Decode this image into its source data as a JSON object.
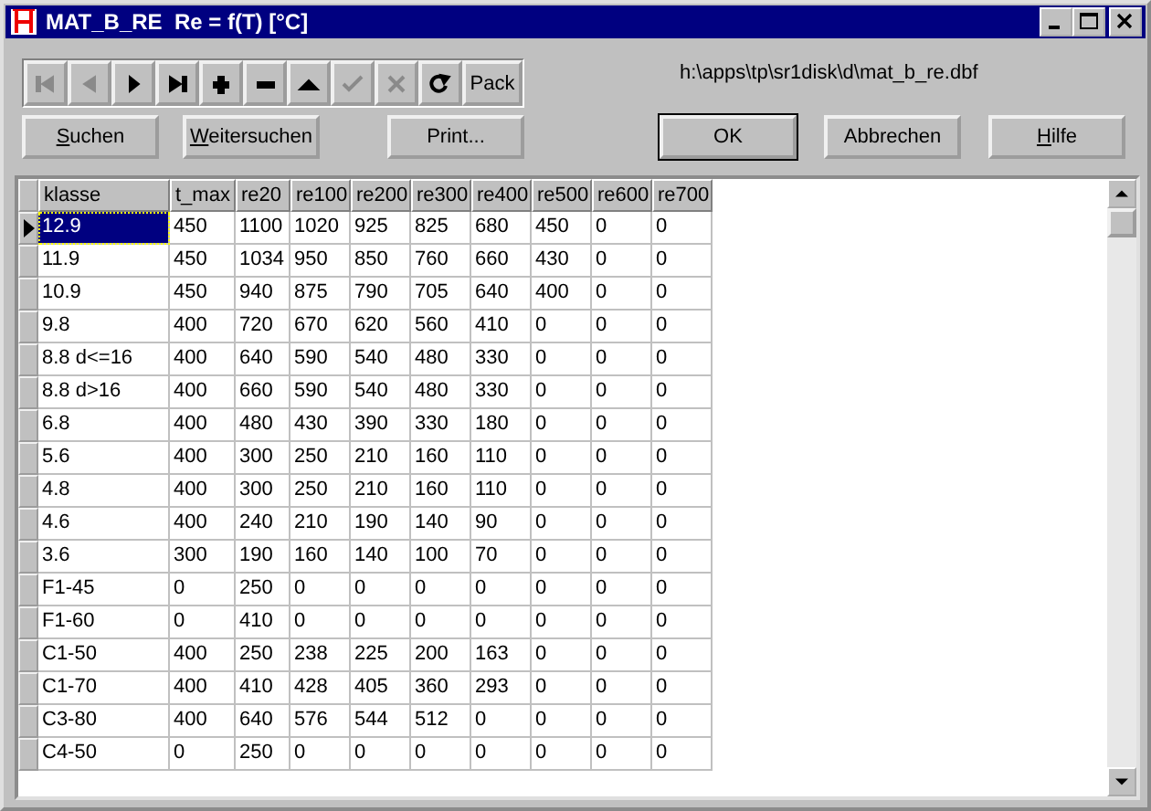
{
  "window": {
    "title": "MAT_B_RE  Re = f(T) [°C]"
  },
  "navigator": [
    {
      "kind": "first",
      "disabled": true
    },
    {
      "kind": "prior",
      "disabled": true
    },
    {
      "kind": "next",
      "disabled": false
    },
    {
      "kind": "last",
      "disabled": false
    },
    {
      "kind": "insert",
      "disabled": false
    },
    {
      "kind": "delete",
      "disabled": false
    },
    {
      "kind": "edit",
      "disabled": false
    },
    {
      "kind": "post",
      "disabled": true
    },
    {
      "kind": "cancel",
      "disabled": true
    },
    {
      "kind": "refresh",
      "disabled": false
    },
    {
      "kind": "text",
      "label": "Pack"
    }
  ],
  "file_path": "h:\\apps\\tp\\sr1disk\\d\\mat_b_re.dbf",
  "buttons_left": [
    {
      "label": "Suchen",
      "mnemonic": true
    },
    {
      "label": "Weitersuchen",
      "mnemonic": true
    },
    {
      "label": "Print...",
      "mnemonic": false
    }
  ],
  "buttons_right": [
    {
      "label": "OK",
      "mnemonic": false,
      "default": true
    },
    {
      "label": "Abbrechen",
      "mnemonic": false,
      "default": false
    },
    {
      "label": "Hilfe",
      "mnemonic": true,
      "default": false
    }
  ],
  "table": {
    "columns": [
      "klasse",
      "t_max",
      "re20",
      "re100",
      "re200",
      "re300",
      "re400",
      "re500",
      "re600",
      "re700"
    ],
    "rows": [
      {
        "selected": true,
        "cells": [
          "12.9",
          "450",
          "1100",
          "1020",
          "925",
          "825",
          "680",
          "450",
          "0",
          "0"
        ]
      },
      {
        "selected": false,
        "cells": [
          "11.9",
          "450",
          "1034",
          "950",
          "850",
          "760",
          "660",
          "430",
          "0",
          "0"
        ]
      },
      {
        "selected": false,
        "cells": [
          "10.9",
          "450",
          "940",
          "875",
          "790",
          "705",
          "640",
          "400",
          "0",
          "0"
        ]
      },
      {
        "selected": false,
        "cells": [
          "9.8",
          "400",
          "720",
          "670",
          "620",
          "560",
          "410",
          "0",
          "0",
          "0"
        ]
      },
      {
        "selected": false,
        "cells": [
          "8.8 d<=16",
          "400",
          "640",
          "590",
          "540",
          "480",
          "330",
          "0",
          "0",
          "0"
        ]
      },
      {
        "selected": false,
        "cells": [
          "8.8 d>16",
          "400",
          "660",
          "590",
          "540",
          "480",
          "330",
          "0",
          "0",
          "0"
        ]
      },
      {
        "selected": false,
        "cells": [
          "6.8",
          "400",
          "480",
          "430",
          "390",
          "330",
          "180",
          "0",
          "0",
          "0"
        ]
      },
      {
        "selected": false,
        "cells": [
          "5.6",
          "400",
          "300",
          "250",
          "210",
          "160",
          "110",
          "0",
          "0",
          "0"
        ]
      },
      {
        "selected": false,
        "cells": [
          "4.8",
          "400",
          "300",
          "250",
          "210",
          "160",
          "110",
          "0",
          "0",
          "0"
        ]
      },
      {
        "selected": false,
        "cells": [
          "4.6",
          "400",
          "240",
          "210",
          "190",
          "140",
          "90",
          "0",
          "0",
          "0"
        ]
      },
      {
        "selected": false,
        "cells": [
          "3.6",
          "300",
          "190",
          "160",
          "140",
          "100",
          "70",
          "0",
          "0",
          "0"
        ]
      },
      {
        "selected": false,
        "cells": [
          "F1-45",
          "0",
          "250",
          "0",
          "0",
          "0",
          "0",
          "0",
          "0",
          "0"
        ]
      },
      {
        "selected": false,
        "cells": [
          "F1-60",
          "0",
          "410",
          "0",
          "0",
          "0",
          "0",
          "0",
          "0",
          "0"
        ]
      },
      {
        "selected": false,
        "cells": [
          "C1-50",
          "400",
          "250",
          "238",
          "225",
          "200",
          "163",
          "0",
          "0",
          "0"
        ]
      },
      {
        "selected": false,
        "cells": [
          "C1-70",
          "400",
          "410",
          "428",
          "405",
          "360",
          "293",
          "0",
          "0",
          "0"
        ]
      },
      {
        "selected": false,
        "cells": [
          "C3-80",
          "400",
          "640",
          "576",
          "544",
          "512",
          "0",
          "0",
          "0",
          "0"
        ]
      },
      {
        "selected": false,
        "cells": [
          "C4-50",
          "0",
          "250",
          "0",
          "0",
          "0",
          "0",
          "0",
          "0",
          "0"
        ]
      }
    ]
  }
}
